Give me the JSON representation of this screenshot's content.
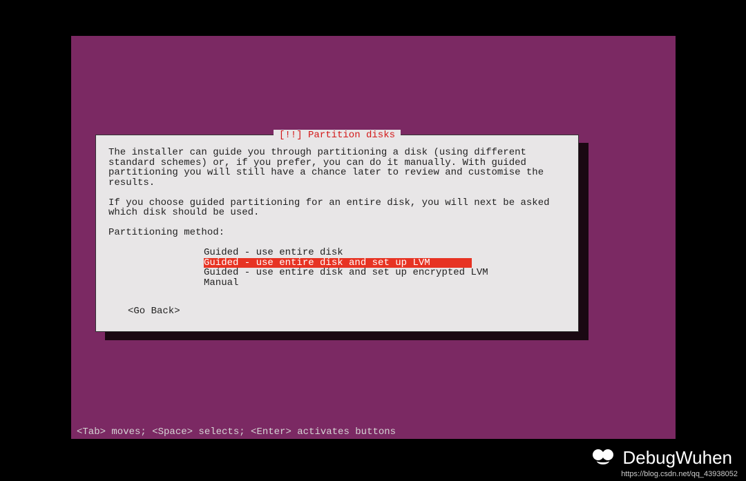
{
  "dialog": {
    "title": "[!!] Partition disks",
    "paragraph1": "The installer can guide you through partitioning a disk (using different standard schemes) or, if you prefer, you can do it manually. With guided partitioning you will still have a chance later to review and customise the results.",
    "paragraph2": "If you choose guided partitioning for an entire disk, you will next be asked which disk should be used.",
    "method_label": "Partitioning method:",
    "options": {
      "opt0": "Guided - use entire disk",
      "opt1": "Guided - use entire disk and set up LVM",
      "opt2": "Guided - use entire disk and set up encrypted LVM",
      "opt3": "Manual"
    },
    "go_back": "<Go Back>"
  },
  "help_bar": "<Tab> moves; <Space> selects; <Enter> activates buttons",
  "watermark": {
    "text": "DebugWuhen",
    "url": "https://blog.csdn.net/qq_43938052"
  }
}
